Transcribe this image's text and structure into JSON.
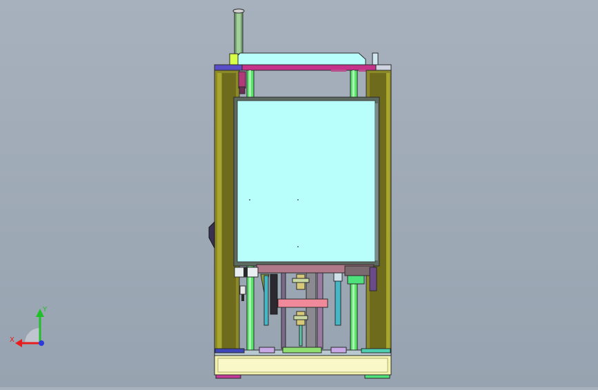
{
  "viewport": {
    "background_top": "#a7b1bd",
    "background_bottom": "#97a3b0"
  },
  "triad": {
    "x_label": "X",
    "y_label": "Y",
    "x_color": "#e81c1c",
    "y_color": "#1fbf2a",
    "z_color": "#2b3ad8"
  },
  "model": {
    "frame_color": "#8c8a28",
    "window_color": "#b8fffb",
    "rail_color": "#59e66a",
    "top_beam_color": "#c4328a",
    "base_color": "#f2f2b0"
  }
}
